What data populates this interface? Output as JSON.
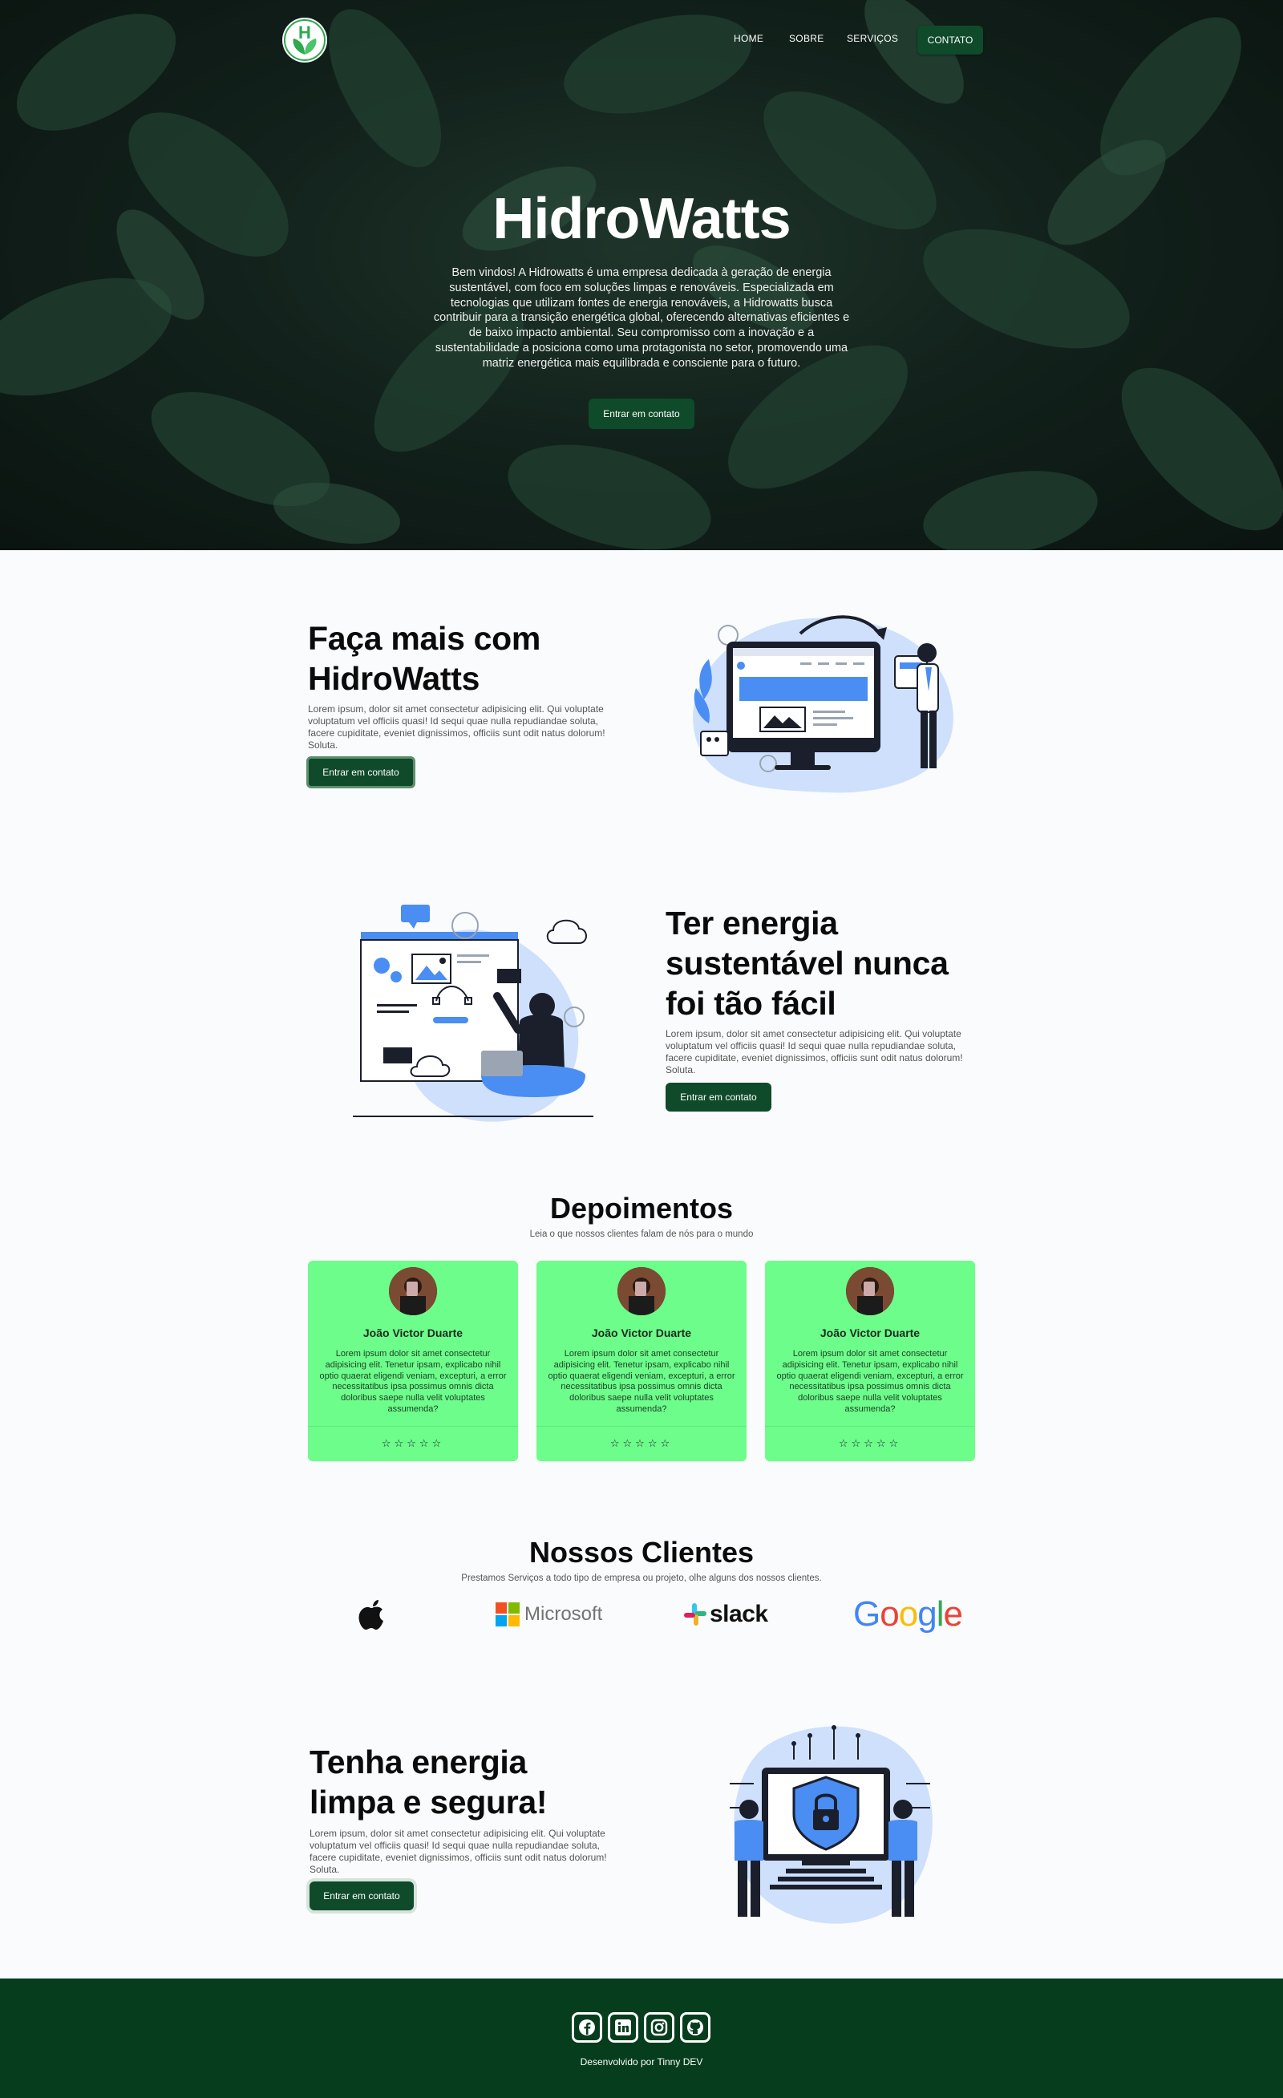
{
  "header": {
    "logo_letter": "H",
    "nav": [
      "HOME",
      "SOBRE",
      "SERVIÇOS"
    ],
    "contact_button": "CONTATO"
  },
  "hero": {
    "title": "HidroWatts",
    "text": "Bem vindos! A Hidrowatts é uma empresa dedicada à geração de energia sustentável, com foco em soluções limpas e renováveis. Especializada em tecnologias que utilizam fontes de energia renováveis, a Hidrowatts busca contribuir para a transição energética global, oferecendo alternativas eficientes e de baixo impacto ambiental. Seu compromisso com a inovação e a sustentabilidade a posiciona como uma protagonista no setor, promovendo uma matriz energética mais equilibrada e consciente para o futuro.",
    "button": "Entrar em contato"
  },
  "sections": [
    {
      "title_line1": "Faça mais com",
      "title_line2": "HidroWatts",
      "text": "Lorem ipsum, dolor sit amet consectetur adipisicing elit. Qui voluptate voluptatum vel officiis quasi! Id sequi quae nulla repudiandae soluta, facere cupiditate, eveniet dignissimos, officiis sunt odit natus dolorum! Soluta.",
      "button": "Entrar em contato"
    },
    {
      "title_line1": "Ter energia",
      "title_line2": "sustentável nunca",
      "title_line3": "foi tão fácil",
      "text": "Lorem ipsum, dolor sit amet consectetur adipisicing elit. Qui voluptate voluptatum vel officiis quasi! Id sequi quae nulla repudiandae soluta, facere cupiditate, eveniet dignissimos, officiis sunt odit natus dolorum! Soluta.",
      "button": "Entrar em contato"
    },
    {
      "title_line1": "Tenha energia",
      "title_line2": "limpa e segura!",
      "text": "Lorem ipsum, dolor sit amet consectetur adipisicing elit. Qui voluptate voluptatum vel officiis quasi! Id sequi quae nulla repudiandae soluta, facere cupiditate, eveniet dignissimos, officiis sunt odit natus dolorum! Soluta.",
      "button": "Entrar em contato"
    }
  ],
  "testimonials": {
    "title": "Depoimentos",
    "subtitle": "Leia o que nossos clientes falam de nós para o mundo",
    "cards": [
      {
        "name": "João Victor Duarte",
        "text": "Lorem ipsum dolor sit amet consectetur adipisicing elit. Tenetur ipsam, explicabo nihil optio quaerat eligendi veniam, excepturi, a error necessitatibus ipsa possimus omnis dicta doloribus saepe nulla velit voluptates assumenda?",
        "stars": "☆☆☆☆☆"
      },
      {
        "name": "João Victor Duarte",
        "text": "Lorem ipsum dolor sit amet consectetur adipisicing elit. Tenetur ipsam, explicabo nihil optio quaerat eligendi veniam, excepturi, a error necessitatibus ipsa possimus omnis dicta doloribus saepe nulla velit voluptates assumenda?",
        "stars": "☆☆☆☆☆"
      },
      {
        "name": "João Victor Duarte",
        "text": "Lorem ipsum dolor sit amet consectetur adipisicing elit. Tenetur ipsam, explicabo nihil optio quaerat eligendi veniam, excepturi, a error necessitatibus ipsa possimus omnis dicta doloribus saepe nulla velit voluptates assumenda?",
        "stars": "☆☆☆☆☆"
      }
    ]
  },
  "clients": {
    "title": "Nossos Clientes",
    "subtitle": "Prestamos Serviços a todo tipo de empresa ou projeto, olhe alguns dos nossos clientes.",
    "logos": [
      "apple-logo",
      "Microsoft",
      "slack",
      "Google"
    ]
  },
  "footer": {
    "social_icons": [
      "facebook-icon",
      "linkedin-icon",
      "instagram-icon",
      "github-icon"
    ],
    "credit": "Desenvolvido por Tinny DEV"
  },
  "colors": {
    "primary_dark_green": "#0f4a2a",
    "footer_green": "#063d1c",
    "card_green": "#6cfd8a",
    "illustration_blue": "#4a8df3",
    "illustration_light_blue": "#cfe0fc"
  }
}
